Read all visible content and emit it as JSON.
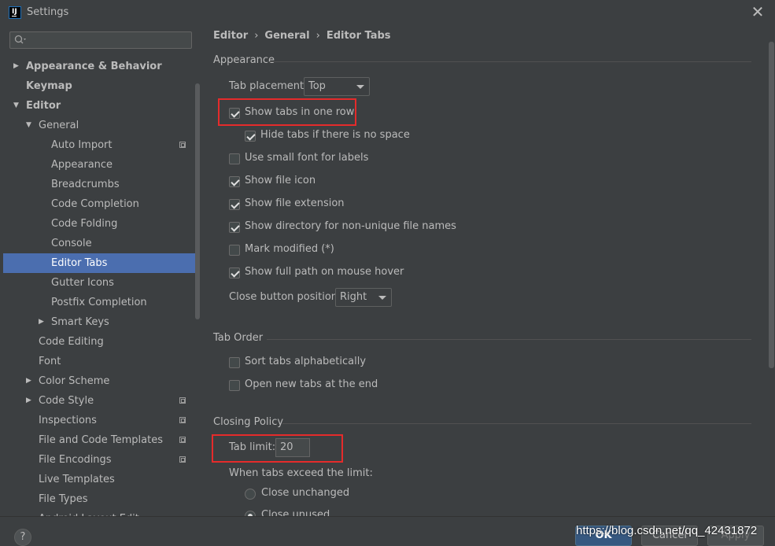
{
  "window": {
    "title": "Settings",
    "close": "✕"
  },
  "search": {
    "placeholder": ""
  },
  "sidebar": {
    "items": [
      {
        "label": "Appearance & Behavior",
        "arrow": "▶"
      },
      {
        "label": "Keymap"
      },
      {
        "label": "Editor",
        "arrow": "▼"
      },
      {
        "label": "General",
        "arrow": "▼"
      },
      {
        "label": "Auto Import"
      },
      {
        "label": "Appearance"
      },
      {
        "label": "Breadcrumbs"
      },
      {
        "label": "Code Completion"
      },
      {
        "label": "Code Folding"
      },
      {
        "label": "Console"
      },
      {
        "label": "Editor Tabs"
      },
      {
        "label": "Gutter Icons"
      },
      {
        "label": "Postfix Completion"
      },
      {
        "label": "Smart Keys",
        "arrow": "▶"
      },
      {
        "label": "Code Editing"
      },
      {
        "label": "Font"
      },
      {
        "label": "Color Scheme",
        "arrow": "▶"
      },
      {
        "label": "Code Style",
        "arrow": "▶"
      },
      {
        "label": "Inspections"
      },
      {
        "label": "File and Code Templates"
      },
      {
        "label": "File Encodings"
      },
      {
        "label": "Live Templates"
      },
      {
        "label": "File Types"
      },
      {
        "label": "Android Layout Edit..."
      }
    ]
  },
  "breadcrumb": {
    "items": [
      "Editor",
      "General",
      "Editor Tabs"
    ],
    "separator": "›"
  },
  "appearance": {
    "title": "Appearance",
    "tab_placement_label": "Tab placement:",
    "tab_placement_value": "Top",
    "options": [
      {
        "label": "Show tabs in one row",
        "checked": true
      },
      {
        "label": "Hide tabs if there is no space",
        "checked": true
      },
      {
        "label": "Use small font for labels",
        "checked": false
      },
      {
        "label": "Show file icon",
        "checked": true
      },
      {
        "label": "Show file extension",
        "checked": true
      },
      {
        "label": "Show directory for non-unique file names",
        "checked": true
      },
      {
        "label": "Mark modified (*)",
        "checked": false
      },
      {
        "label": "Show full path on mouse hover",
        "checked": true
      }
    ],
    "close_button_label": "Close button position:",
    "close_button_value": "Right"
  },
  "tab_order": {
    "title": "Tab Order",
    "options": [
      {
        "label": "Sort tabs alphabetically",
        "checked": false
      },
      {
        "label": "Open new tabs at the end",
        "checked": false
      }
    ]
  },
  "closing_policy": {
    "title": "Closing Policy",
    "tab_limit_label": "Tab limit:",
    "tab_limit_value": "20",
    "exceed_label": "When tabs exceed the limit:",
    "radios": [
      {
        "label": "Close unchanged",
        "selected": false
      },
      {
        "label": "Close unused",
        "selected": true
      }
    ]
  },
  "buttons": {
    "help": "?",
    "ok": "OK",
    "cancel": "Cancel",
    "apply": "Apply"
  },
  "watermark": "https://blog.csdn.net/qq_42431872",
  "colors": {
    "selection": "#4b6eaf",
    "highlight_box": "#e52b2b",
    "background": "#3c3f41"
  }
}
